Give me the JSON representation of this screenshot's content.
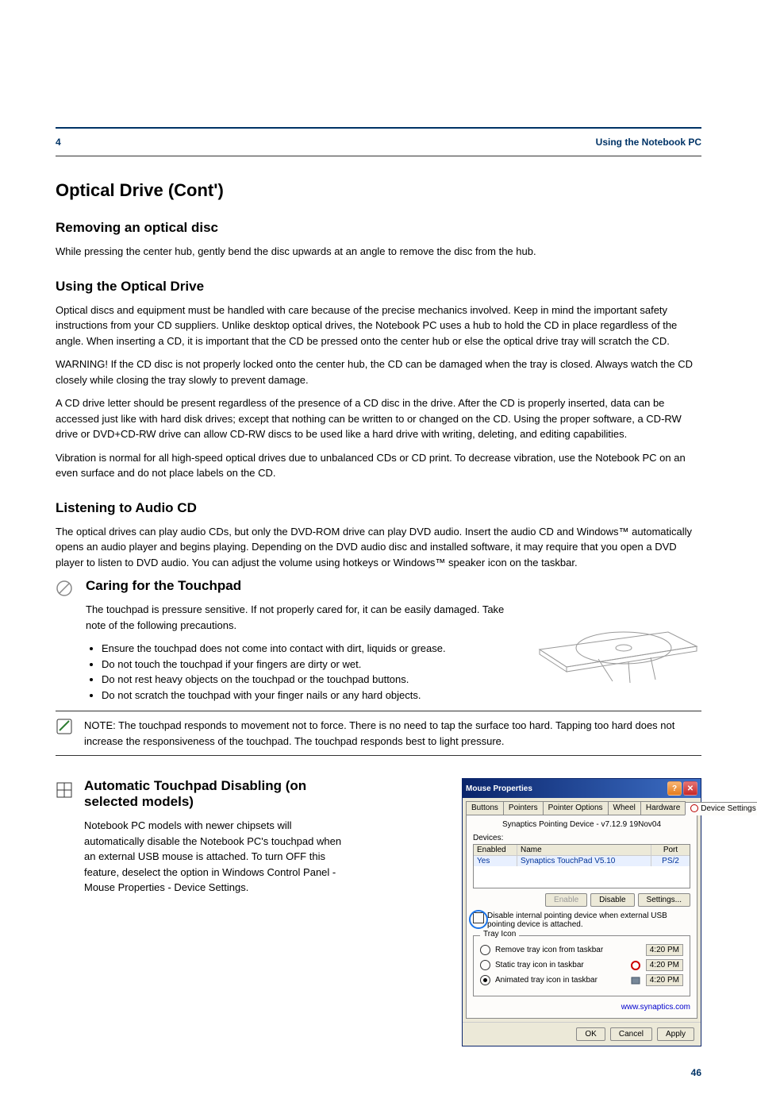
{
  "header": {
    "section_number": "4",
    "section_title": "Using the Notebook PC"
  },
  "optical_drive": {
    "title": "Optical Drive (Cont')",
    "removing_heading": "Removing an optical disc",
    "removing_text": "While pressing the center hub, gently bend the disc upwards at an angle to remove the disc from the hub.",
    "using_heading": "Using the Optical Drive",
    "using_text": "Optical discs and equipment must be handled with care because of the precise mechanics involved. Keep in mind the important safety instructions from your CD suppliers. Unlike desktop optical drives, the Notebook PC uses a hub to hold the CD in place regardless of the angle. When inserting a CD, it is important that the CD be pressed onto the center hub or else the optical drive tray will scratch the CD.",
    "warning_text": "WARNING! If the CD disc is not properly locked onto the center hub, the CD can be damaged when the tray is closed. Always watch the CD closely while closing the tray slowly to prevent damage.",
    "drive_letter_text": "A CD drive letter should be present regardless of the presence of a CD disc in the drive. After the CD is properly inserted, data can be accessed just like with hard disk drives; except that nothing can be written to or changed on the CD. Using the proper software, a CD-RW drive or DVD+CD-RW drive can allow CD-RW discs to be used like a hard drive with writing, deleting, and editing capabilities.",
    "vibration_text": "Vibration is normal for all high-speed optical drives due to unbalanced CDs or CD print. To decrease vibration, use the Notebook PC on an even surface and do not place labels on the CD.",
    "audio_heading": "Listening to Audio CD",
    "audio_text": "The optical drives can play audio CDs, but only the DVD-ROM drive can play DVD audio. Insert the audio CD and Windows™ automatically opens an audio player and begins playing. Depending on the DVD audio disc and installed software, it may require that you open a DVD player to listen to DVD audio. You can adjust the volume using hotkeys or Windows™ speaker icon on the taskbar.",
    "caring_heading": "Caring for the Touchpad",
    "caring_text": "The touchpad is pressure sensitive. If not properly cared for, it can be easily damaged. Take note of the following precautions.",
    "caring_bullets": [
      "Ensure the touchpad does not come into contact with dirt, liquids or grease.",
      "Do not touch the touchpad if your fingers are dirty or wet.",
      "Do not rest heavy objects on the touchpad or the touchpad buttons.",
      "Do not scratch the touchpad with your finger nails or any hard objects."
    ],
    "note_text": "NOTE: The touchpad responds to movement not to force. There is no need to tap the surface too hard. Tapping too hard does not increase the responsiveness of the touchpad. The touchpad responds best to light pressure.",
    "auto_disable_heading": "Automatic Touchpad Disabling (on selected models)",
    "auto_disable_text": "Notebook PC models with newer chipsets will automatically disable the Notebook PC's touchpad when an external USB mouse is attached. To turn OFF this feature, deselect the option in Windows Control Panel - Mouse Properties - Device Settings."
  },
  "mouse_dialog": {
    "title": "Mouse Properties",
    "tabs": [
      "Buttons",
      "Pointers",
      "Pointer Options",
      "Wheel",
      "Hardware",
      "Device Settings"
    ],
    "active_tab": "Device Settings",
    "driver_line": "Synaptics Pointing Device - v7.12.9 19Nov04",
    "devices_label": "Devices:",
    "columns": {
      "enabled": "Enabled",
      "name": "Name",
      "port": "Port"
    },
    "row": {
      "enabled": "Yes",
      "name": "Synaptics TouchPad V5.10",
      "port": "PS/2"
    },
    "buttons": {
      "enable": "Enable",
      "disable": "Disable",
      "settings": "Settings..."
    },
    "checkbox_label": "Disable internal pointing device when external USB pointing device is attached.",
    "tray_group": "Tray Icon",
    "radio_options": [
      {
        "label": "Remove tray icon from taskbar",
        "time": "4:20 PM"
      },
      {
        "label": "Static tray icon in taskbar",
        "time": "4:20 PM"
      },
      {
        "label": "Animated tray icon in taskbar",
        "time": "4:20 PM"
      }
    ],
    "selected_radio_index": 2,
    "link": "www.synaptics.com",
    "footer": {
      "ok": "OK",
      "cancel": "Cancel",
      "apply": "Apply"
    }
  },
  "page_number": "46"
}
